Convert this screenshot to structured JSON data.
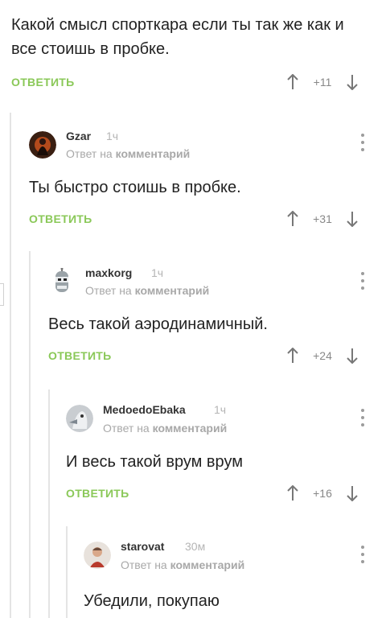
{
  "root_comment": {
    "text": "Какой смысл спорткара если ты так же как и все стоишь в пробке.",
    "reply_label": "ОТВЕТИТЬ",
    "rating": "+11"
  },
  "replies": [
    {
      "username": "Gzar",
      "age": "1ч",
      "sub_prefix": "Ответ на",
      "sub_link": "комментарий",
      "text": "Ты быстро стоишь в пробке.",
      "reply_label": "ОТВЕТИТЬ",
      "rating": "+31"
    },
    {
      "username": "maxkorg",
      "age": "1ч",
      "sub_prefix": "Ответ на",
      "sub_link": "комментарий",
      "text": "Весь такой аэродинамичный.",
      "reply_label": "ОТВЕТИТЬ",
      "rating": "+24"
    },
    {
      "username": "MedoedoEbaka",
      "age": "1ч",
      "sub_prefix": "Ответ на",
      "sub_link": "комментарий",
      "text": "И весь такой врум врум",
      "reply_label": "ОТВЕТИТЬ",
      "rating": "+16"
    },
    {
      "username": "starovat",
      "age": "30м",
      "sub_prefix": "Ответ на",
      "sub_link": "комментарий",
      "text": "Убедили, покупаю"
    }
  ],
  "colors": {
    "accent_green": "#8ac858",
    "rail": "#e4e4e4",
    "muted_text": "#a8a8a8"
  },
  "icons": [
    "arrow-up-icon",
    "arrow-down-icon",
    "kebab-menu-icon",
    "avatar"
  ]
}
